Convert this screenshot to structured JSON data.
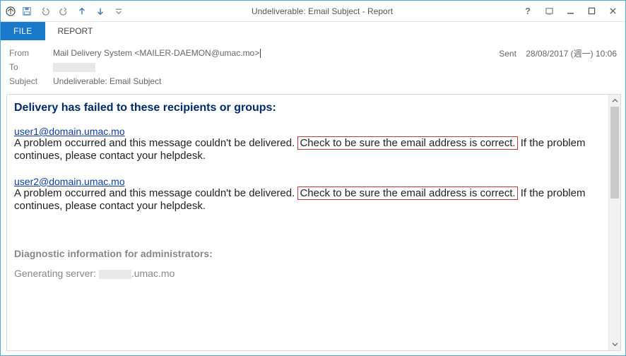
{
  "window": {
    "title": "Undeliverable: Email Subject - Report"
  },
  "tabs": {
    "file": "FILE",
    "report": "REPORT"
  },
  "header": {
    "from_label": "From",
    "from_value": "Mail Delivery System <MAILER-DAEMON@umac.mo>",
    "to_label": "To",
    "subject_label": "Subject",
    "subject_value": "Undeliverable: Email Subject",
    "sent_label": "Sent",
    "sent_value": "28/08/2017 (週一) 10:06"
  },
  "body": {
    "failure_heading": "Delivery has failed to these recipients or groups:",
    "recipients": [
      {
        "email": "user1@domain.umac.mo",
        "msg_a": "A problem occurred and this message couldn't be delivered.",
        "msg_boxed": "Check to be sure the email address is correct.",
        "msg_b": "If the problem continues, please contact your helpdesk."
      },
      {
        "email": "user2@domain.umac.mo",
        "msg_a": "A problem occurred and this message couldn't be delivered.",
        "msg_boxed": "Check to be sure the email address is correct.",
        "msg_b": "If the problem continues, please contact your helpdesk."
      }
    ],
    "diag_heading": "Diagnostic information for administrators:",
    "gen_server_label": "Generating server: ",
    "gen_server_suffix": ".umac.mo"
  }
}
